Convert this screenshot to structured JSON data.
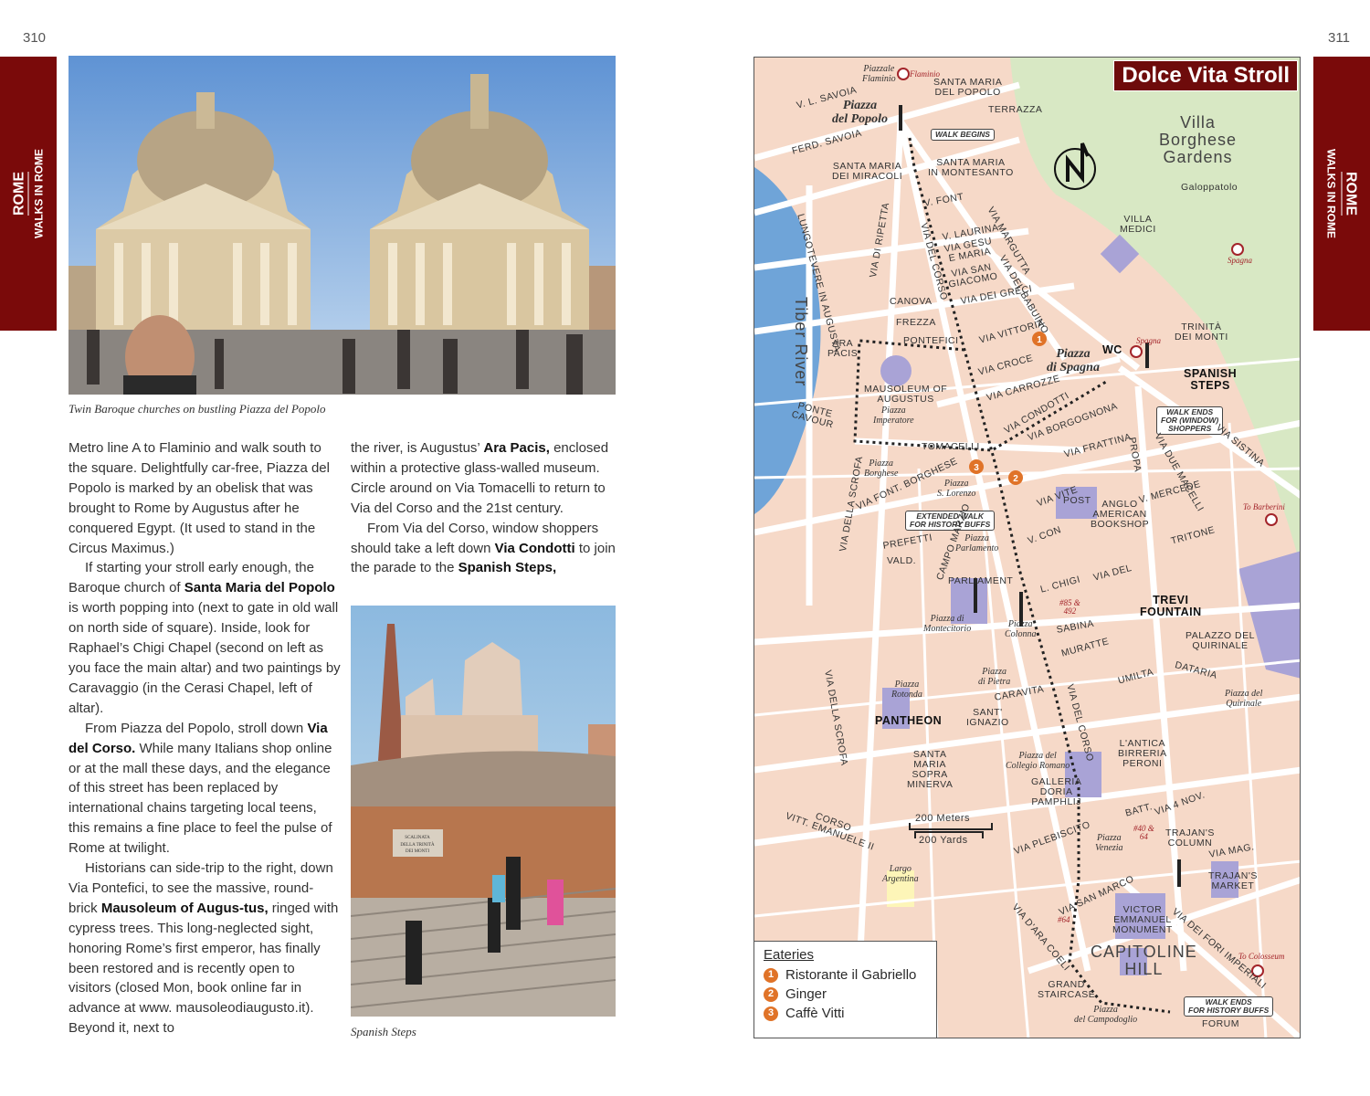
{
  "left_page": {
    "page_number": "310",
    "tab": {
      "section": "ROME",
      "chapter": "WALKS IN ROME"
    },
    "photo1_caption": "Twin Baroque churches on bustling Piazza del Popolo",
    "photo2_caption": "Spanish Steps",
    "photo2_sign": "SCALINATA\nDELLA TRINITÀ\nDEI MONTI",
    "column1": [
      [
        {
          "t": "Metro line A to Flaminio and walk south to the square. Delightfully car-free, Piazza del Popolo is marked by an obelisk that was brought to Rome by Augustus after he conquered Egypt. (It used to stand in the Circus Maximus.)"
        }
      ],
      [
        {
          "t": "If starting your stroll early enough, the Baroque church of "
        },
        {
          "t": "Santa Maria del Popolo",
          "b": true
        },
        {
          "t": " is worth popping into (next to gate in old wall on north side of square). Inside, look for Raphael’s Chigi Chapel (second on left as you face the main altar) and two paintings by Caravaggio (in the Cerasi Chapel, left of altar)."
        }
      ],
      [
        {
          "t": "From Piazza del Popolo, stroll down "
        },
        {
          "t": "Via del Corso.",
          "b": true
        },
        {
          "t": " While many Italians shop online or at the mall these days, and the elegance of this street has been replaced by international chains targeting local teens, this remains a fine place to feel the pulse of Rome at twilight."
        }
      ],
      [
        {
          "t": "Historians can side-trip to the right, down Via Pontefici, to see the massive, round-brick "
        },
        {
          "t": "Mausoleum of Augus-tus,",
          "b": true
        },
        {
          "t": " ringed with cypress trees. This long-neglected sight, honoring Rome’s first emperor, has finally been restored and is recently open to visitors (closed Mon, book online far in advance at www. mausoleodiaugusto.it). Beyond it, next to"
        }
      ]
    ],
    "column2": [
      [
        {
          "t": "the river, is Augustus’ "
        },
        {
          "t": "Ara Pacis,",
          "b": true
        },
        {
          "t": " enclosed within a protective glass-walled museum. Circle around on Via Tomacelli to return to Via del Corso and the 21st century."
        }
      ],
      [
        {
          "t": "From Via del Corso, window shoppers should take a left down "
        },
        {
          "t": "Via Condotti",
          "b": true
        },
        {
          "t": " to join the parade to the "
        },
        {
          "t": "Spanish Steps,",
          "b": true
        }
      ]
    ]
  },
  "right_page": {
    "page_number": "311",
    "tab": {
      "section": "ROME",
      "chapter": "WALKS IN ROME"
    },
    "map": {
      "title": "Dolce Vita Stroll",
      "legend": {
        "heading": "Eateries",
        "items": [
          {
            "n": "1",
            "name": "Ristorante il Gabriello"
          },
          {
            "n": "2",
            "name": "Ginger"
          },
          {
            "n": "3",
            "name": "Caffè Vitti"
          }
        ]
      },
      "labels": {
        "piazzale_flaminio": "Piazzale\nFlaminio",
        "flaminio_metro": "Flaminio",
        "sm_popolo": "SANTA MARIA\nDEL POPOLO",
        "piazza_popolo": "Piazza\ndel Popolo",
        "terrazza": "TERRAZZA",
        "walk_begins": "WALK BEGINS",
        "vl_savoia": "V. L. SAVOIA",
        "ferd_savoia": "FERD. SAVOIA",
        "sm_miracoli": "SANTA MARIA\nDEI MIRACOLI",
        "sm_montesanto": "SANTA MARIA\nIN MONTESANTO",
        "villa_borghese": "Villa\nBorghese\nGardens",
        "galoppatolo": "Galoppatolo",
        "villa_medici": "VILLA\nMEDICI",
        "spagna_metro1": "Spagna",
        "v_font": "V. FONT",
        "via_del_corso1": "VIA  DEL  CORSO",
        "tiber": "Tiber   River",
        "lungotevere": "LUNGOTEVERE IN AUGUSTA",
        "ripetta": "VIA DI RIPETTA",
        "laurina": "V. LAURINA",
        "gesu": "VIA GESU\nE MARIA",
        "san_giacomo": "VIA SAN\nGIACOMO",
        "greci": "VIA DEI GRECI",
        "margutta": "VIA MARGUTTA",
        "babuino": "VIA DEL BABUINO",
        "canova": "CANOVA",
        "frezza": "FREZZA",
        "pontefici": "PONTEFICI",
        "vittoria": "VIA VITTORIA",
        "ara_pacis": "ARA\nPACIS",
        "mausoleum": "MAUSOLEUM OF\nAUGUSTUS",
        "piazza_imperatore": "Piazza\nImperatore",
        "ponte_cavour": "PONTE\nCAVOUR",
        "croce": "VIA CROCE",
        "carrozze": "VIA CARROZZE",
        "piazza_spagna": "Piazza\ndi Spagna",
        "spagna_metro2": "Spagna",
        "wc": "WC",
        "trinita": "TRINITÀ\nDEI MONTI",
        "spanish_steps": "SPANISH\nSTEPS",
        "walk_ends_shoppers": "WALK ENDS\nFOR (WINDOW)\nSHOPPERS",
        "sistina": "VIA SISTINA",
        "condotti": "VIA CONDOTTI",
        "tomacelli": "TOMACELLI",
        "borgognona": "VIA BORGOGNONA",
        "frattina": "VIA   FRATTINA",
        "propa": "PROPA",
        "due_macelli": "VIA DUE MACELLI",
        "piazza_borghese": "Piazza\nBorghese",
        "font_borghese": "VIA FONT. BORGHESE",
        "piazza_lorenzo": "Piazza\nS. Lorenzo",
        "extended_walk": "EXTENDED WALK\nFOR HISTORY BUFFS",
        "vite": "VIA VITE",
        "post": "POST",
        "bookshop": "ANGLO\nAMERICAN\nBOOKSHOP",
        "mercede": "V. MERCEDE",
        "to_barberini": "To Barberini",
        "scrofa1": "VIA DELLA SCROFA",
        "prefetti": "PREFETTI",
        "vald": "VALD.",
        "campo_marzio": "CAMPO MARZIO",
        "piazza_parlamento": "Piazza\nParlamento",
        "v_con": "V. CON",
        "tritone": "TRITONE",
        "via_del2": "VIA    DEL",
        "chigi": "L. CHIGI",
        "bus_85": "#85 &\n492",
        "parliament": "PARLIAMENT",
        "trevi": "TREVI\nFOUNTAIN",
        "montecitorio": "Piazza di\nMontecitorio",
        "colonna": "Piazza\nColonna",
        "sabina": "SABINA",
        "quirinale_palace": "PALAZZO DEL\nQUIRINALE",
        "muratte": "MURATTE",
        "dataria": "DATARIA",
        "umilta": "UMILTA",
        "pietra": "Piazza\ndi Pietra",
        "rotonda": "Piazza\nRotonda",
        "caravita": "CARAVITA",
        "piazza_quirinale": "Piazza del\nQuirinale",
        "scrofa2": "VIA DELLA SCROFA",
        "pantheon": "PANTHEON",
        "ignazio": "SANT'\nIGNAZIO",
        "via_del_corso2": "VIA  DEL  CORSO",
        "peroni": "L'ANTICA\nBIRRERIA\nPERONI",
        "minerva": "SANTA\nMARIA\nSOPRA\nMINERVA",
        "collegio": "Piazza del\nCollegio Romano",
        "doria": "GALLERIA\nDORIA\nPAMPHLIJ",
        "corso_vitt": "CORSO\nVITT. EMANUELE II",
        "scale_m": "200 Meters",
        "scale_y": "200 Yards",
        "plebiscito": "VIA PLEBISCITO",
        "batt": "BATT.",
        "via4nov": "VIA 4 NOV.",
        "bus_40": "#40 &\n64",
        "venezia": "Piazza\nVenezia",
        "trajan_col": "TRAJAN'S\nCOLUMN",
        "via_mag": "VIA MAG.",
        "argentina": "Largo\nArgentina",
        "trajan_mkt": "TRAJAN'S\nMARKET",
        "san_marco": "VIA SAN MARCO",
        "ara_coeli": "VIA D'ARA COELI",
        "bus_64": "#64",
        "victor": "VICTOR\nEMMANUEL\nMONUMENT",
        "capitoline": "CAPITOLINE\nHILL",
        "fori": "VIA DEI FORI IMPERIALI",
        "to_colosseum": "To Colosseum",
        "staircase": "GRAND\nSTAIRCASE",
        "walk_ends_history": "WALK ENDS\nFOR HISTORY BUFFS",
        "campidoglio": "Piazza\ndel Campodoglio",
        "forum": "FORUM"
      }
    }
  },
  "colors": {
    "tab": "#7a0a0a",
    "map_bg": "#f6d9c8",
    "park": "#d8e8c4",
    "river": "#6fa4d8",
    "building": "#a9a3d6",
    "eatery": "#e07328"
  }
}
